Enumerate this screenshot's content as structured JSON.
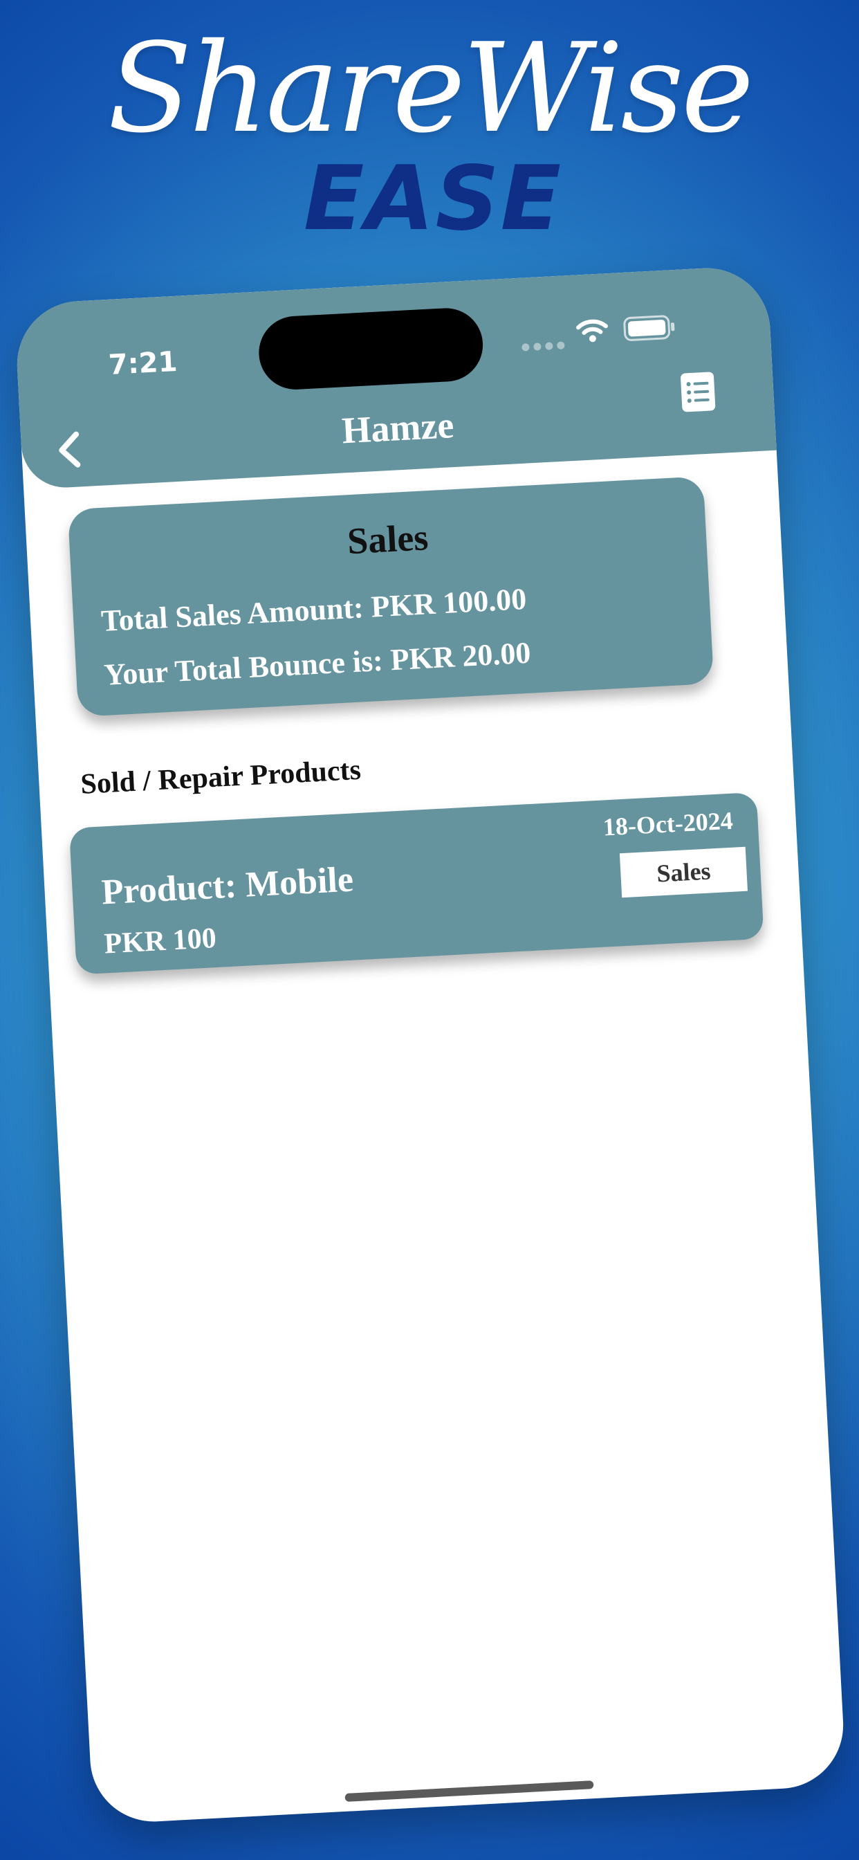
{
  "promo": {
    "title": "ShareWise",
    "subtitle": "EASE"
  },
  "status_bar": {
    "time": "7:21"
  },
  "header": {
    "title": "Hamze",
    "back_icon": "chevron-left-icon",
    "menu_icon": "list-document-icon"
  },
  "summary": {
    "title": "Sales",
    "total_sales": "Total Sales Amount: PKR 100.00",
    "total_bounce": "Your Total Bounce is: PKR 20.00"
  },
  "section_label": "Sold / Repair Products",
  "products": [
    {
      "name": "Product: Mobile",
      "price": "PKR 100",
      "date": "18-Oct-2024",
      "type": "Sales"
    }
  ],
  "colors": {
    "card": "#65949e",
    "brand_dark": "#0f2f86",
    "background_light": "#46b1dc",
    "background_dark": "#0c47a6"
  }
}
